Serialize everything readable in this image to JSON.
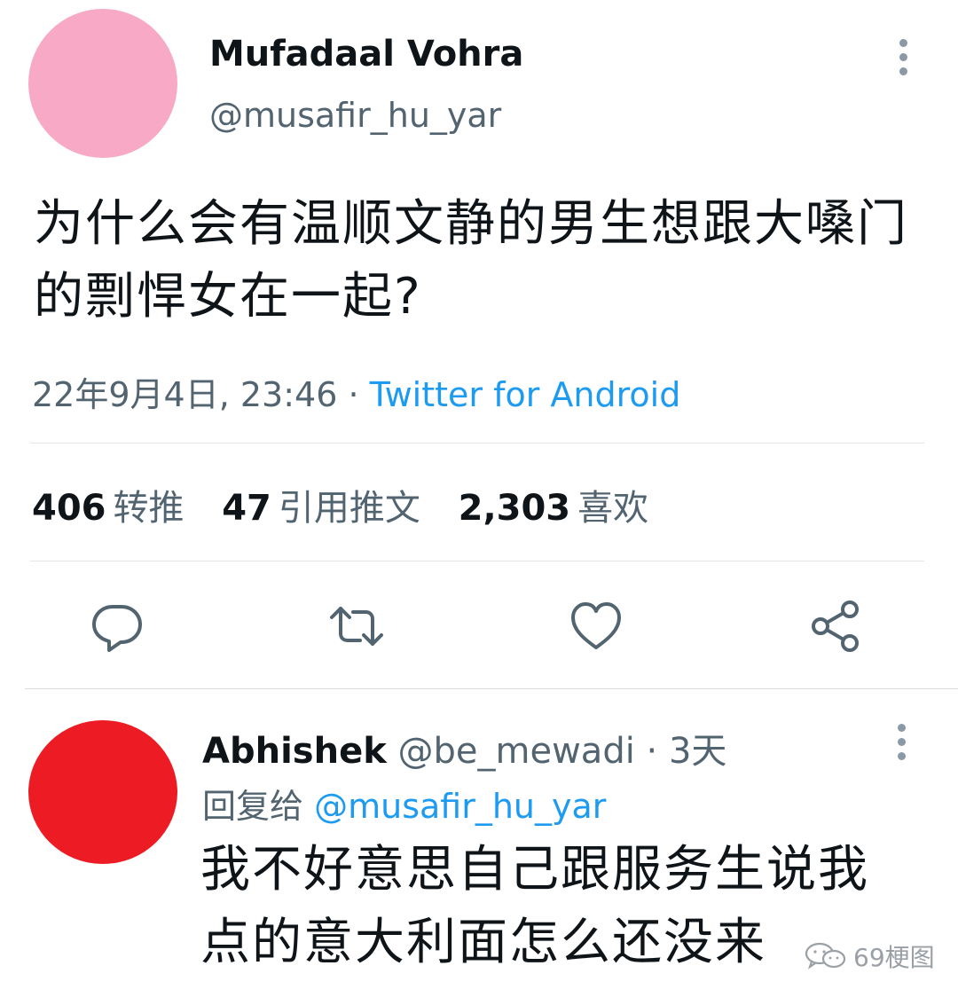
{
  "tweet": {
    "author_name": "Mufadaal Vohra",
    "author_handle": "@musafir_hu_yar",
    "text": "为什么会有温顺文静的男生想跟大嗓门\n的剽悍女在一起?",
    "timestamp": "22年9月4日, 23:46",
    "separator": " · ",
    "source": "Twitter for Android",
    "stats": {
      "retweets_value": "406",
      "retweets_label": "转推",
      "quotes_value": "47",
      "quotes_label": "引用推文",
      "likes_value": "2,303",
      "likes_label": "喜欢"
    },
    "avatar_color": "#f8a9c5"
  },
  "actions": {
    "reply_icon": "reply-icon",
    "retweet_icon": "retweet-icon",
    "like_icon": "heart-icon",
    "share_icon": "share-icon"
  },
  "reply": {
    "author_name": "Abhishek",
    "author_handle": "@be_mewadi",
    "time": "· 3天",
    "reply_to_label": "回复给",
    "reply_to_handle": "@musafir_hu_yar",
    "text": "我不好意思自己跟服务生说我\n点的意大利面怎么还没来",
    "avatar_color": "#ed1c24"
  },
  "watermark": {
    "text": "69梗图",
    "icon": "wechat-icon"
  },
  "colors": {
    "accent": "#1d9bf0",
    "secondary_text": "#536471"
  }
}
